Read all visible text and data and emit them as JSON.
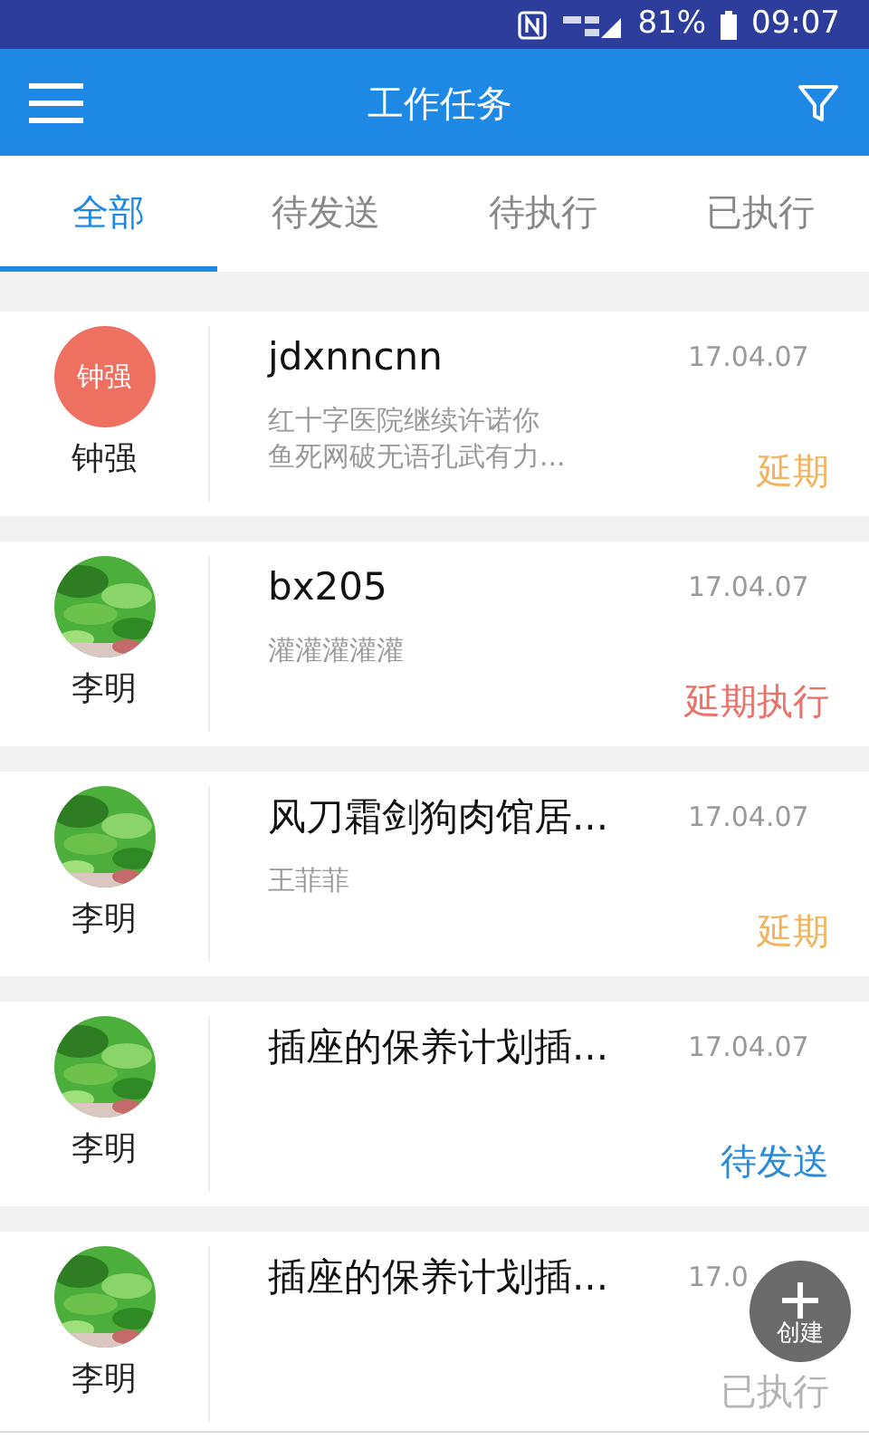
{
  "status_bar": {
    "battery": "81%",
    "time": "09:07"
  },
  "header": {
    "title": "工作任务"
  },
  "tabs": [
    {
      "label": "全部",
      "selected": true
    },
    {
      "label": "待发送",
      "selected": false
    },
    {
      "label": "待执行",
      "selected": false
    },
    {
      "label": "已执行",
      "selected": false
    }
  ],
  "tasks": [
    {
      "avatar": {
        "kind": "initials",
        "text": "钟强",
        "color": "#ee7060"
      },
      "name": "钟强",
      "title": "jdxnncnn",
      "date": "17.04.07",
      "description": "红十字医院继续许诺你鱼死网破无语孔武有力...",
      "status": {
        "label": "延期",
        "color": "#f0b35f"
      }
    },
    {
      "name": "李明",
      "title": "bx205",
      "date": "17.04.07",
      "description": "灌灌灌灌灌",
      "status": {
        "label": "延期执行",
        "color": "#e8716a"
      }
    },
    {
      "name": "李明",
      "title": "风刀霜剑狗肉馆居...",
      "date": "17.04.07",
      "description": "王菲菲",
      "status": {
        "label": "延期",
        "color": "#f0b35f"
      }
    },
    {
      "name": "李明",
      "title": "插座的保养计划插...",
      "date": "17.04.07",
      "status": {
        "label": "待发送",
        "color": "#2a8ad6"
      }
    },
    {
      "name": "李明",
      "title": "插座的保养计划插...",
      "date": "17.0",
      "status": {
        "label": "已执行",
        "color": "#b4b4b4"
      }
    }
  ],
  "fab": {
    "label": "创建"
  }
}
